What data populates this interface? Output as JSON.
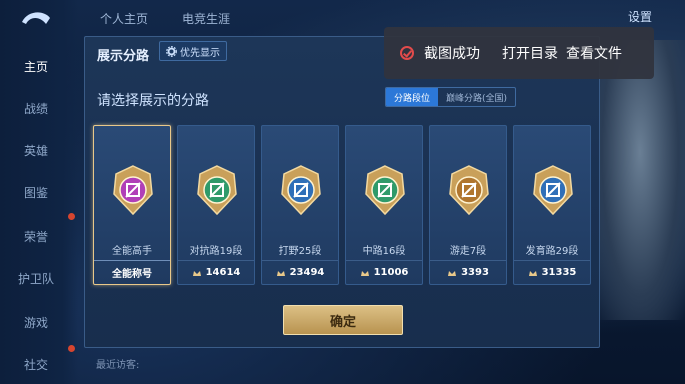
{
  "nav": {
    "side_items": [
      "主页",
      "战绩",
      "英雄",
      "图鉴",
      "荣誉",
      "护卫队",
      "游戏",
      "社交"
    ],
    "top_tabs": [
      "个人主页",
      "电竞生涯"
    ],
    "settings_label": "设置"
  },
  "toast": {
    "message": "截图成功",
    "open_dir": "打开目录",
    "view_file": "查看文件"
  },
  "modal": {
    "title": "展示分路",
    "priority_tag": "优先显示",
    "subtitle": "请选择展示的分路",
    "tabs": [
      "分路段位",
      "巅峰分路(全国)"
    ],
    "confirm": "确定"
  },
  "cards": [
    {
      "name": "全能高手",
      "bottom": "全能称号",
      "selected": true,
      "color": "#b03fb8",
      "icon": "all-round-emblem"
    },
    {
      "name": "对抗路19段",
      "bottom": "14614",
      "selected": false,
      "color": "#2f9a6a",
      "icon": "clash-lane-emblem"
    },
    {
      "name": "打野25段",
      "bottom": "23494",
      "selected": false,
      "color": "#2f6fb8",
      "icon": "jungle-emblem"
    },
    {
      "name": "中路16段",
      "bottom": "11006",
      "selected": false,
      "color": "#2f9a6a",
      "icon": "mid-lane-emblem"
    },
    {
      "name": "游走7段",
      "bottom": "3393",
      "selected": false,
      "color": "#b0762f",
      "icon": "roam-emblem"
    },
    {
      "name": "发育路29段",
      "bottom": "31335",
      "selected": false,
      "color": "#2f6fb8",
      "icon": "farm-lane-emblem"
    }
  ],
  "bottom_hint": "最近访客:"
}
